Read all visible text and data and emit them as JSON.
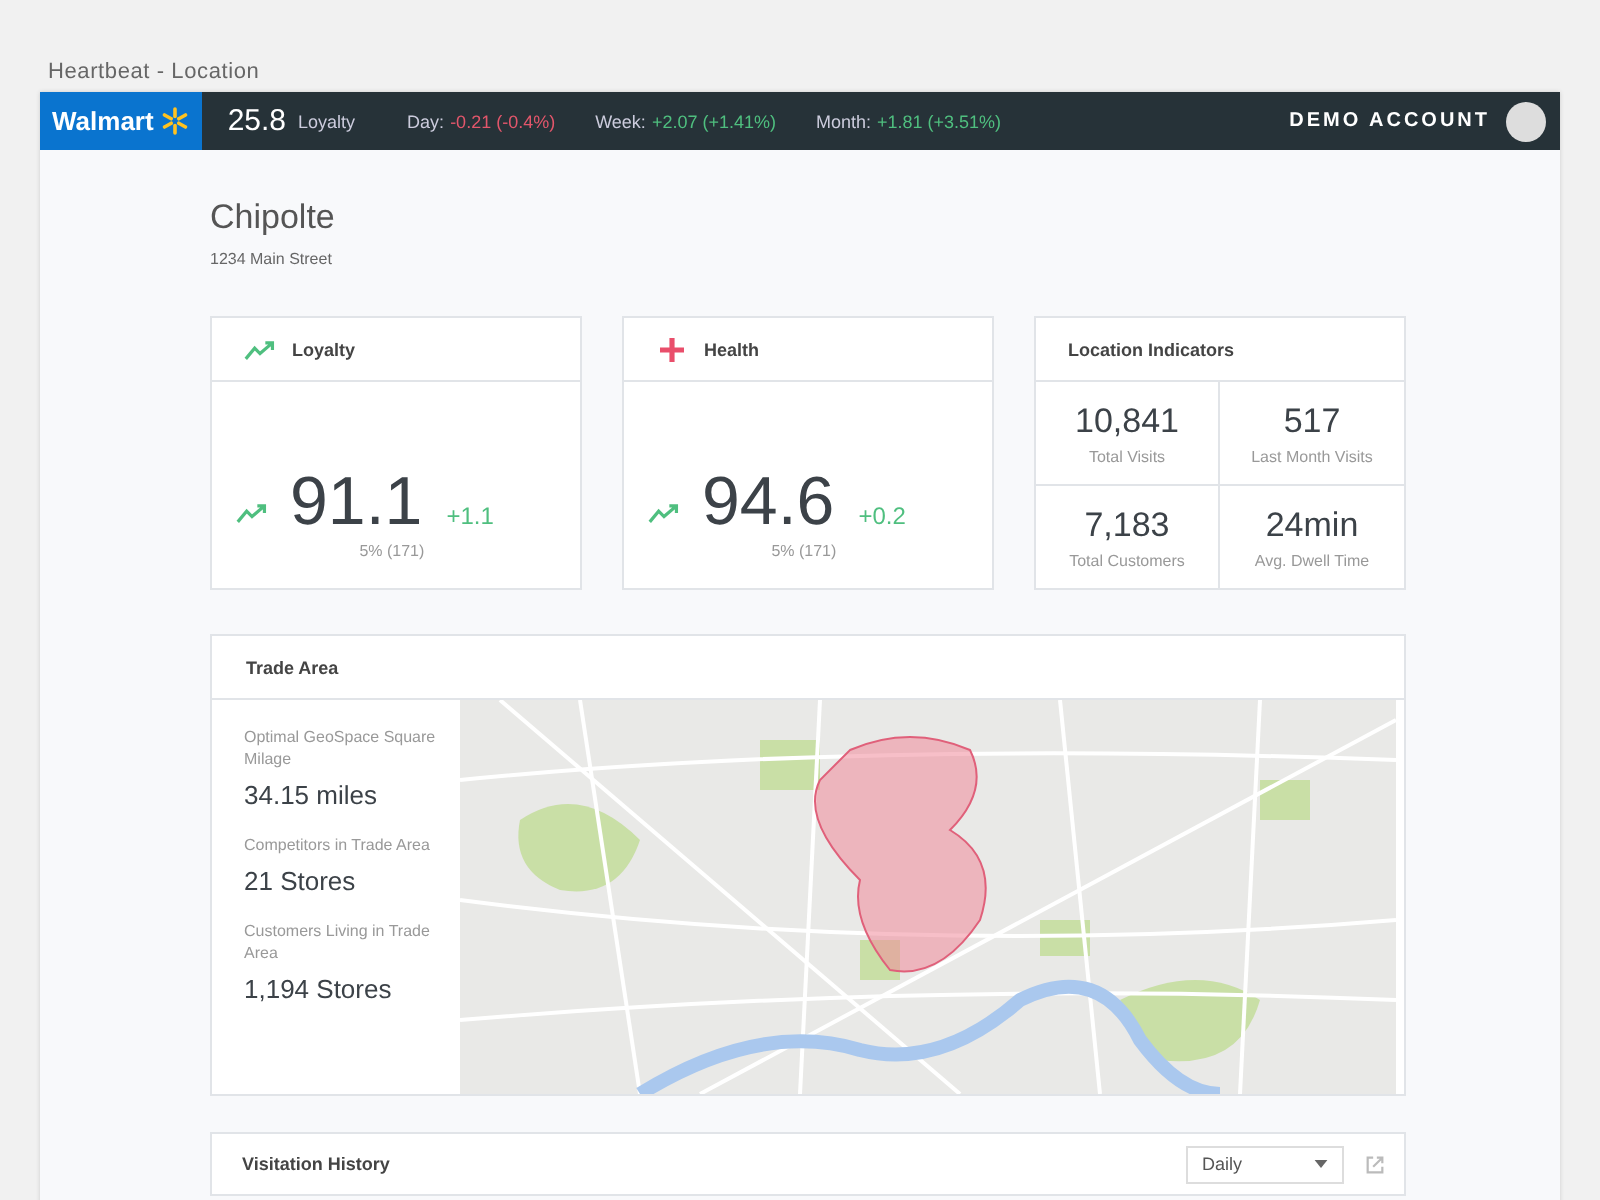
{
  "page_caption": "Heartbeat - Location",
  "top_bar": {
    "brand": "Walmart",
    "score": "25.8",
    "score_label": "Loyalty",
    "changes": [
      {
        "label": "Day:",
        "value": "-0.21 (-0.4%)",
        "positive": false
      },
      {
        "label": "Week:",
        "value": "+2.07 (+1.41%)",
        "positive": true
      },
      {
        "label": "Month:",
        "value": "+1.81 (+3.51%)",
        "positive": true
      }
    ],
    "account": "DEMO ACCOUNT"
  },
  "location": {
    "name": "Chipolte",
    "address": "1234 Main Street"
  },
  "score_cards": [
    {
      "kind": "trend",
      "title": "Loyalty",
      "value": "91.1",
      "change": "+1.1",
      "positive": true,
      "detail": "5% (171)"
    },
    {
      "kind": "health",
      "title": "Health",
      "value": "94.6",
      "change": "+0.2",
      "positive": true,
      "detail": "5% (171)"
    }
  ],
  "indicators": {
    "title": "Location Indicators",
    "items": [
      {
        "value": "10,841",
        "label": "Total Visits"
      },
      {
        "value": "517",
        "label": "Last Month Visits"
      },
      {
        "value": "7,183",
        "label": "Total Customers"
      },
      {
        "value": "24min",
        "label": "Avg. Dwell Time"
      }
    ]
  },
  "trade_area": {
    "title": "Trade Area",
    "stats": [
      {
        "label": "Optimal GeoSpace Square Milage",
        "value": "34.15 miles"
      },
      {
        "label": "Competitors in Trade Area",
        "value": "21 Stores"
      },
      {
        "label": "Customers Living in Trade Area",
        "value": "1,194 Stores"
      }
    ]
  },
  "visitation_history": {
    "title": "Visitation History",
    "period": "Daily"
  }
}
